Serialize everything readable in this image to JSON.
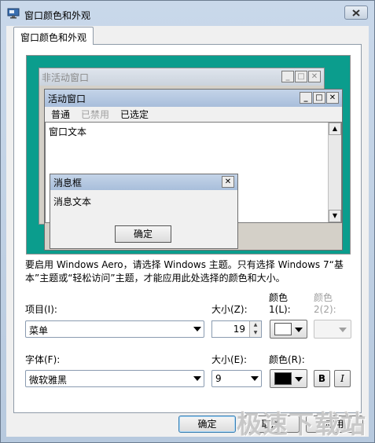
{
  "window": {
    "title": "窗口颜色和外观"
  },
  "tab": {
    "label": "窗口颜色和外观"
  },
  "preview": {
    "inactive_title": "非活动窗口",
    "active_title": "活动窗口",
    "menu_normal": "普通",
    "menu_disabled": "已禁用",
    "menu_selected": "已选定",
    "window_text": "窗口文本",
    "msgbox_title": "消息框",
    "msgbox_text": "消息文本",
    "msgbox_ok": "确定"
  },
  "notice": "要启用 Windows Aero，请选择 Windows 主题。只有选择 Windows 7“基本”主题或“轻松访问”主题，才能应用此处选择的颜色和大小。",
  "item": {
    "label": "项目(I):",
    "value": "菜单"
  },
  "item_size": {
    "label": "大小(Z):",
    "value": "19"
  },
  "color1": {
    "label_line1": "颜色",
    "label_line2": "1(L):",
    "swatch": "#ffffff"
  },
  "color2": {
    "label_line1": "颜色",
    "label_line2": "2(2):"
  },
  "font": {
    "label": "字体(F):",
    "value": "微软雅黑"
  },
  "font_size": {
    "label": "大小(E):",
    "value": "9"
  },
  "font_color": {
    "label": "颜色(R):",
    "swatch": "#000000"
  },
  "bold": "B",
  "italic": "I",
  "buttons": {
    "ok": "确定",
    "cancel": "取消",
    "apply": "应用"
  },
  "watermark": "极速下载站",
  "colors": {
    "preview_bg": "#0b9d8d",
    "titlebar_active": "#a8bedb"
  }
}
